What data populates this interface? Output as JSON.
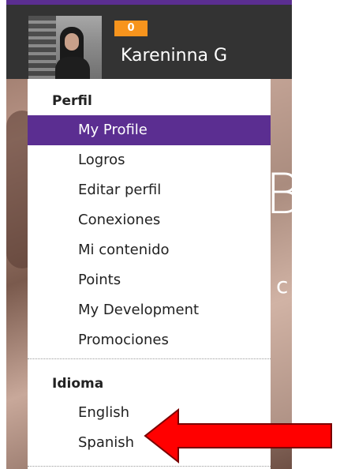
{
  "header": {
    "username": "Kareninna G",
    "badge_count": "0"
  },
  "background": {
    "partial_letter_1": "B",
    "partial_letter_2": "c"
  },
  "menu": {
    "profile_section_title": "Perfil",
    "profile_items": [
      {
        "label": "My Profile",
        "active": true
      },
      {
        "label": "Logros"
      },
      {
        "label": "Editar perfil"
      },
      {
        "label": "Conexiones"
      },
      {
        "label": "Mi contenido"
      },
      {
        "label": "Points"
      },
      {
        "label": "My Development"
      },
      {
        "label": "Promociones"
      }
    ],
    "language_section_title": "Idioma",
    "language_items": [
      {
        "label": "English"
      },
      {
        "label": "Spanish"
      }
    ]
  },
  "colors": {
    "accent_purple": "#5b2e91",
    "header_dark": "#333333",
    "badge_orange": "#f7941d",
    "arrow_red": "#ff0000"
  }
}
